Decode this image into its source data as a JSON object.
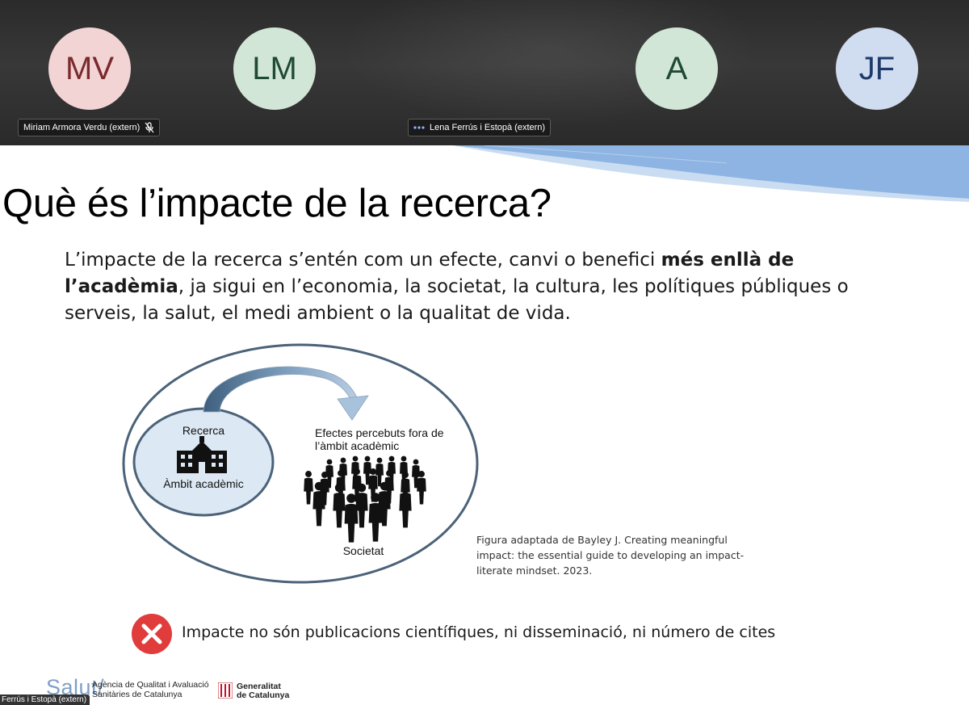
{
  "participants": [
    {
      "initials": "MV",
      "bg": "#f2d4d5",
      "fg": "#7a2a2c"
    },
    {
      "initials": "LM",
      "bg": "#d2e6d8",
      "fg": "#1f4a33"
    },
    {
      "initials": "A",
      "bg": "#d2e6d8",
      "fg": "#1f4a33"
    },
    {
      "initials": "JF",
      "bg": "#d0dcef",
      "fg": "#1e3a6a"
    }
  ],
  "name_tags": [
    {
      "label": "Miriam Armora Verdu (extern)",
      "icon": "mic-muted-icon"
    },
    {
      "label": "Lena Ferrús i Estopà (extern)",
      "icon": "speaking-dots-icon"
    }
  ],
  "slide": {
    "title": "Què és l’impacte de la recerca?",
    "body_before": "L’impacte de la recerca s’entén com un efecte, canvi o benefici ",
    "body_bold": "més enllà de l’acadèmia",
    "body_after": ", ja sigui en l’economia, la societat, la cultura, les polítiques públiques o serveis, la salut, el medi ambient o la qualitat de vida.",
    "diagram": {
      "inner_top": "Recerca",
      "inner_bottom": "Àmbit acadèmic",
      "effects_line1": "Efectes percebuts fora de",
      "effects_line2": "l’àmbit acadèmic",
      "outer_label": "Societat",
      "icons": [
        "school-building-icon",
        "crowd-icon",
        "curved-arrow-icon"
      ]
    },
    "caption": "Figura adaptada de Bayley J. Creating meaningful impact: the essential guide to developing an impact-literate mindset. 2023.",
    "not_impact": "Impacte no són publicacions científiques, ni disseminació, ni número de cites",
    "colors": {
      "accent_blue": "#7fa8d8",
      "no_red": "#e03c3c"
    }
  },
  "footer": {
    "salut_logo": "Salut/",
    "aquas_line1": "Agència de Qualitat i Avaluació",
    "aquas_line2": "Sanitàries de Catalunya",
    "gencat_line1": "Generalitat",
    "gencat_line2": "de Catalunya"
  },
  "presenter_tag": "Ferrús i Estopà (extern)"
}
